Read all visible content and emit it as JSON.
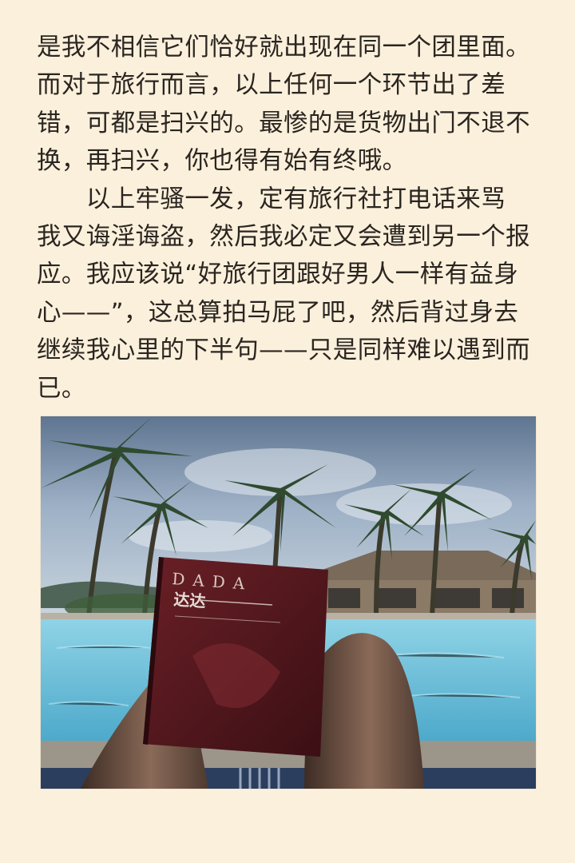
{
  "text": {
    "lines": [
      "是我不相信它们恰好就出现在同一个团里面。",
      "而对于旅行而言，以上任何一个环节出了差",
      "错，可都是扫兴的。最惨的是货物出门不退不",
      "换，再扫兴，你也得有始有终哦。",
      "　　以上牢骚一发，定有旅行社打电话来骂",
      "我又诲淫诲盗，然后我必定又会遭到另一个报",
      "应。我应该说“好旅行团跟好男人一样有益身",
      "心——”，这总算拍马屁了吧，然后背过身去",
      "继续我心里的下半句——只是同样难以遇到而",
      "已。"
    ]
  },
  "photo": {
    "book_title": "DADA",
    "book_subtitle": "达达"
  },
  "colors": {
    "page_background": "#fbf0dc",
    "text": "#2b2520",
    "book_cover": "#5a1a1e",
    "pool_water": "#6fc2dc",
    "sky": "#8da3bd"
  }
}
